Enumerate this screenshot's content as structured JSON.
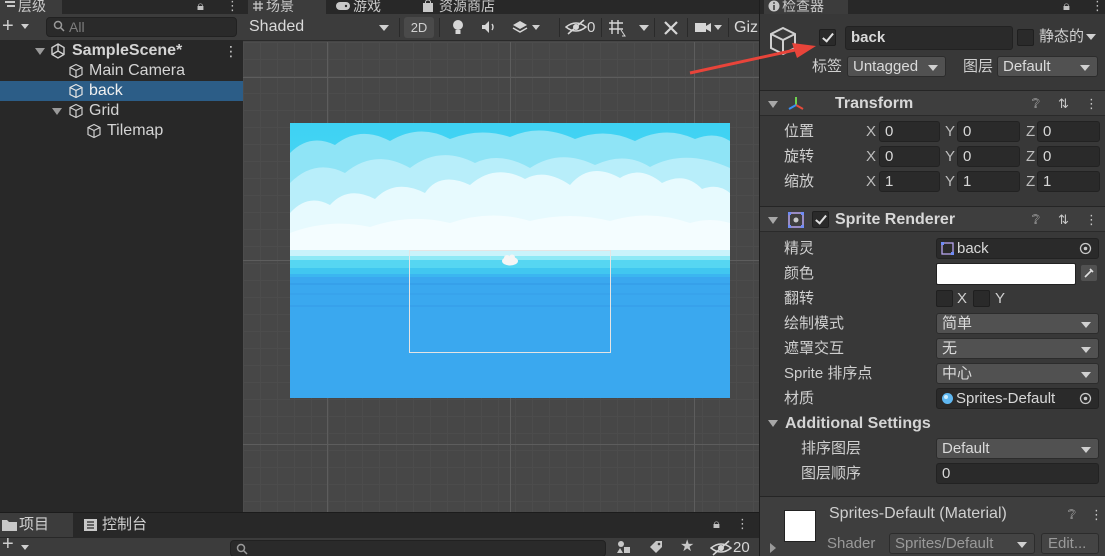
{
  "hierarchy": {
    "tab_label": "层级",
    "search_placeholder": "All",
    "items": [
      {
        "label": "SampleScene*"
      },
      {
        "label": "Main Camera"
      },
      {
        "label": "back"
      },
      {
        "label": "Grid"
      },
      {
        "label": "Tilemap"
      }
    ]
  },
  "scene": {
    "tabs": [
      {
        "label": "场景"
      },
      {
        "label": "游戏"
      },
      {
        "label": "资源商店"
      }
    ],
    "shading_mode": "Shaded",
    "mode_2d": "2D",
    "hidden_count": "0",
    "gizmos_label": "Giz"
  },
  "inspector": {
    "tab_label": "检查器",
    "object_name": "back",
    "static_label": "静态的",
    "tag_label": "标签",
    "tag_value": "Untagged",
    "layer_label": "图层",
    "layer_value": "Default",
    "transform": {
      "title": "Transform",
      "rows": [
        {
          "label": "位置",
          "x": "0",
          "y": "0",
          "z": "0"
        },
        {
          "label": "旋转",
          "x": "0",
          "y": "0",
          "z": "0"
        },
        {
          "label": "缩放",
          "x": "1",
          "y": "1",
          "z": "1"
        }
      ],
      "axis_x": "X",
      "axis_y": "Y",
      "axis_z": "Z"
    },
    "sprite_renderer": {
      "title": "Sprite Renderer",
      "sprite_label": "精灵",
      "sprite_value": "back",
      "color_label": "颜色",
      "color_value": "#ffffff",
      "flip_label": "翻转",
      "flip_x": "X",
      "flip_y": "Y",
      "draw_mode_label": "绘制模式",
      "draw_mode_value": "简单",
      "mask_label": "遮罩交互",
      "mask_value": "无",
      "sort_point_label": "Sprite 排序点",
      "sort_point_value": "中心",
      "material_label": "材质",
      "material_value": "Sprites-Default",
      "additional_title": "Additional Settings",
      "sorting_layer_label": "排序图层",
      "sorting_layer_value": "Default",
      "order_label": "图层顺序",
      "order_value": "0"
    },
    "material": {
      "title": "Sprites-Default (Material)",
      "shader_label": "Shader",
      "shader_value": "Sprites/Default",
      "edit_label": "Edit..."
    }
  },
  "bottom": {
    "tabs": [
      {
        "label": "项目"
      },
      {
        "label": "控制台"
      }
    ],
    "hidden_count": "20"
  },
  "colors": {
    "selection": "#2c5d87",
    "annotation_arrow": "#e8443a",
    "sky_top": "#3fd3f3",
    "sea": "#3aa8ef"
  }
}
